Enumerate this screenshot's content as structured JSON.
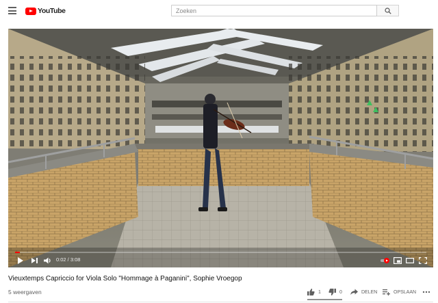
{
  "masthead": {
    "menu_icon": "hamburger-menu-icon",
    "logo_text": "YouTube",
    "search_placeholder": "Zoeken",
    "search_icon": "search-icon"
  },
  "player": {
    "current_time": "0:02",
    "duration": "3:08",
    "time_display": "0:02 / 3:08",
    "progress_fraction": 0.011,
    "controls": [
      "play-icon",
      "next-icon",
      "volume-icon",
      "autoplay-toggle-icon",
      "miniplayer-icon",
      "theater-icon",
      "fullscreen-icon"
    ],
    "accent_color": "#ff0000"
  },
  "video": {
    "title": "Vieuxtemps Capriccio for Viola Solo \"Hommage à Paganini\", Sophie Vroegop",
    "views": "5 weergaven",
    "likes": "1",
    "dislikes": "0",
    "share_label": "DELEN",
    "save_label": "OPSLAAN",
    "more_icon": "more-icon"
  }
}
